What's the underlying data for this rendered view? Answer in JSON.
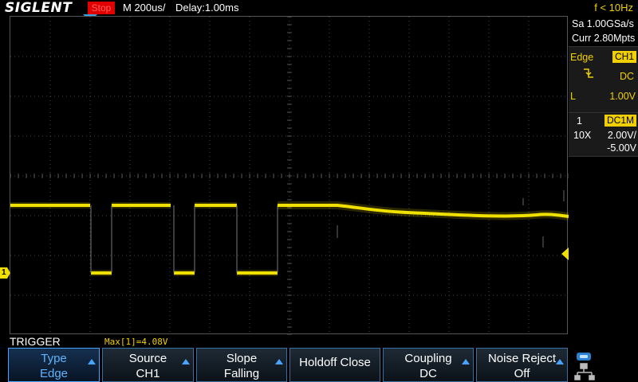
{
  "header": {
    "logo": "SIGLENT",
    "run_status": "Stop",
    "timebase": "M 200us/",
    "delay": "Delay:1.00ms",
    "frequency": "f < 10Hz"
  },
  "acquisition": {
    "sample_rate": "Sa 1.00GSa/s",
    "memory_depth": "Curr 2.80Mpts"
  },
  "trigger_panel": {
    "type": "Edge",
    "source": "CH1",
    "coupling": "DC",
    "level_label": "L",
    "level": "1.00V"
  },
  "channel_panel": {
    "channel_number": "1",
    "coupling_impedance": "DC1M",
    "probe": "10X",
    "volts_per_div": "2.00V/",
    "offset": "-5.00V"
  },
  "markers": {
    "channel1": "1"
  },
  "menu": {
    "title": "TRIGGER",
    "measurement": "Max[1]=4.08V",
    "softkeys": [
      {
        "line1": "Type",
        "line2": "Edge",
        "has_arrow": true,
        "active": true
      },
      {
        "line1": "Source",
        "line2": "CH1",
        "has_arrow": true,
        "active": false
      },
      {
        "line1": "Slope",
        "line2": "Falling",
        "has_arrow": true,
        "active": false
      },
      {
        "line1": "Holdoff Close",
        "line2": "",
        "has_arrow": false,
        "active": false
      },
      {
        "line1": "Coupling",
        "line2": "DC",
        "has_arrow": true,
        "active": false
      },
      {
        "line1": "Noise Reject",
        "line2": "Off",
        "has_arrow": true,
        "active": false
      }
    ]
  },
  "colors": {
    "trace": "#f0e000",
    "accent": "#4aa3ff",
    "run_status_bg": "#e00000"
  },
  "icons": {
    "trigger_position": "down-triangle-icon",
    "trigger_level": "left-triangle-icon",
    "trigger_slope": "falling-edge-icon",
    "usb": "usb-icon",
    "network": "network-icon"
  }
}
